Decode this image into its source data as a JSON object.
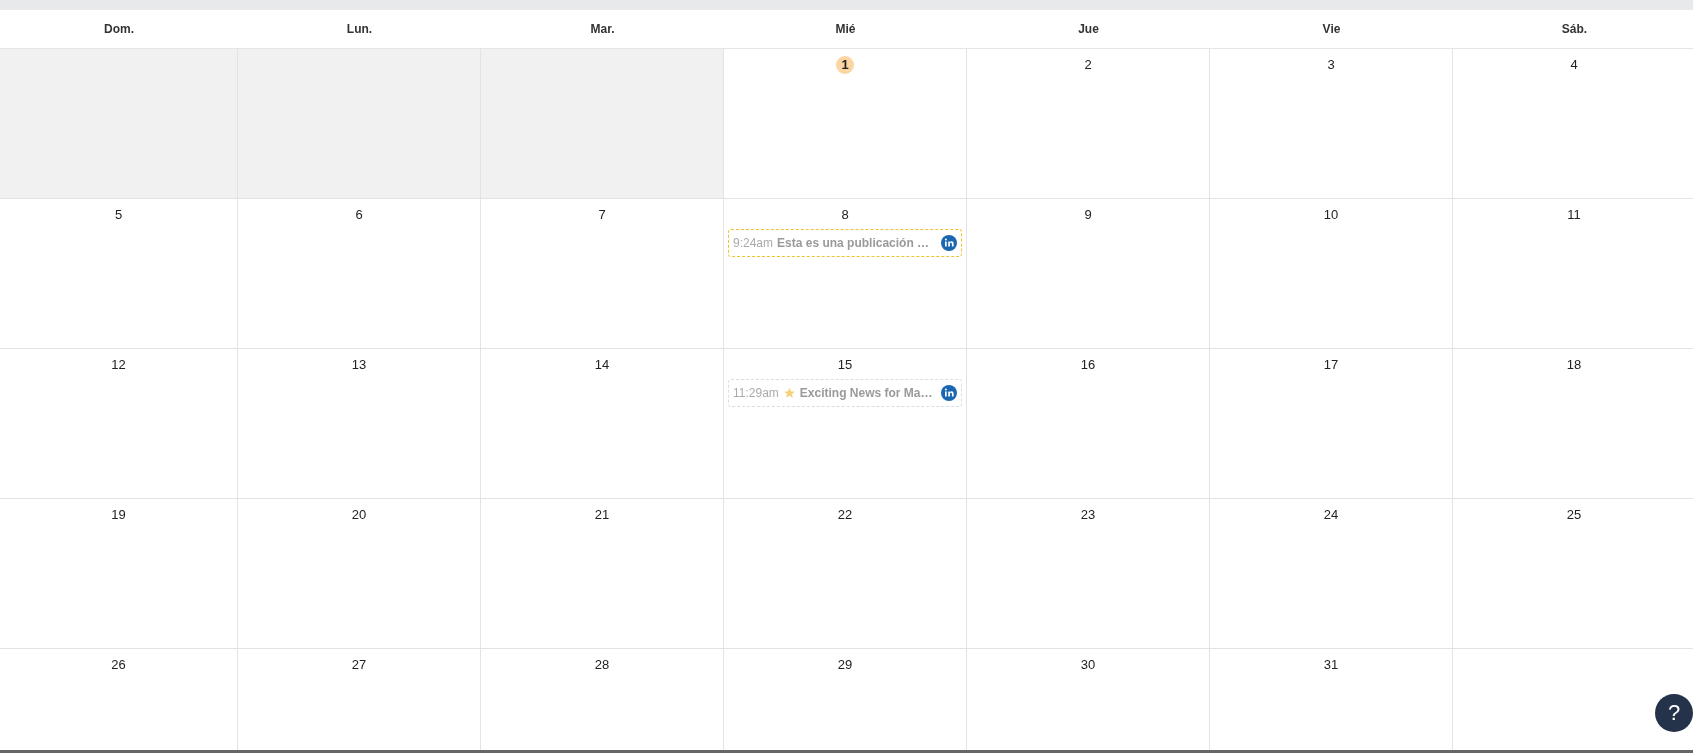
{
  "weekdays": [
    "Dom.",
    "Lun.",
    "Mar.",
    "Mié",
    "Jue",
    "Vie",
    "Sáb."
  ],
  "weeks": [
    [
      {
        "outside": true
      },
      {
        "outside": true
      },
      {
        "outside": true
      },
      {
        "day": "1",
        "today": true
      },
      {
        "day": "2",
        "today": false
      },
      {
        "day": "3",
        "today": false
      },
      {
        "day": "4",
        "today": false
      }
    ],
    [
      {
        "day": "5",
        "today": false
      },
      {
        "day": "6",
        "today": false
      },
      {
        "day": "7",
        "today": false
      },
      {
        "day": "8",
        "today": false,
        "events": [
          {
            "time": "9:24am",
            "title": "Esta es una publicación …",
            "highlighted": true,
            "star": false,
            "linkedin": true
          }
        ]
      },
      {
        "day": "9",
        "today": false
      },
      {
        "day": "10",
        "today": false
      },
      {
        "day": "11",
        "today": false
      }
    ],
    [
      {
        "day": "12",
        "today": false
      },
      {
        "day": "13",
        "today": false
      },
      {
        "day": "14",
        "today": false
      },
      {
        "day": "15",
        "today": false,
        "events": [
          {
            "time": "11:29am",
            "star": true,
            "title": "Exciting News for Ma…",
            "highlighted": false,
            "linkedin": true
          }
        ]
      },
      {
        "day": "16",
        "today": false
      },
      {
        "day": "17",
        "today": false
      },
      {
        "day": "18",
        "today": false
      }
    ],
    [
      {
        "day": "19",
        "today": false
      },
      {
        "day": "20",
        "today": false
      },
      {
        "day": "21",
        "today": false
      },
      {
        "day": "22",
        "today": false
      },
      {
        "day": "23",
        "today": false
      },
      {
        "day": "24",
        "today": false
      },
      {
        "day": "25",
        "today": false
      }
    ],
    [
      {
        "day": "26",
        "today": false
      },
      {
        "day": "27",
        "today": false
      },
      {
        "day": "28",
        "today": false
      },
      {
        "day": "29",
        "today": false
      },
      {
        "day": "30",
        "today": false
      },
      {
        "day": "31",
        "today": false
      }
    ]
  ],
  "help_button": {
    "label": "?"
  }
}
